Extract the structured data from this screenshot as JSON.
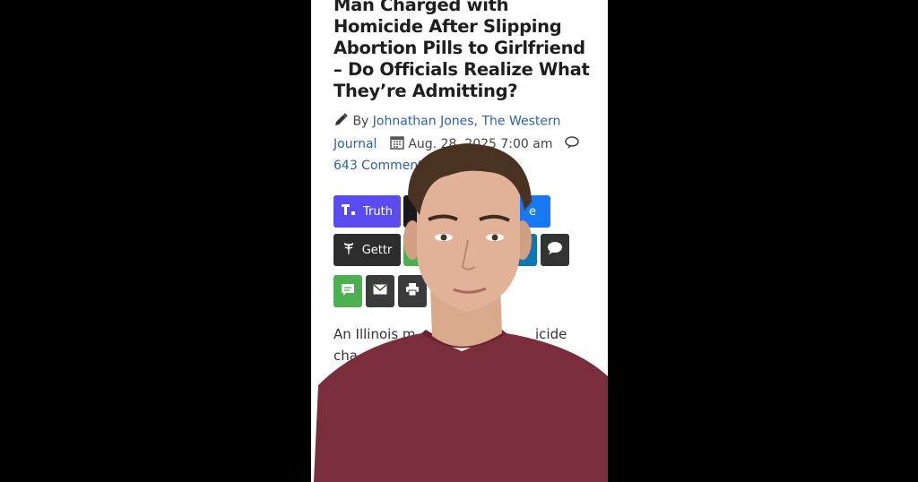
{
  "article": {
    "headline_lines": [
      "Man Charged with",
      "Homicide After Slipping",
      "Abortion Pills to Girlfriend",
      "– Do Officials Realize What",
      "They’re Admitting?"
    ],
    "byline_prefix": "By",
    "author_line1": "Johnathan Jones, The Western",
    "author_line2": "Journal",
    "date": "Aug. 28, 2025 7:00 am",
    "comments": "643 Comments"
  },
  "share": {
    "truth_label": "Truth",
    "gettr_label": "Gettr",
    "partial_label_1": "e",
    "partial_label_2": "in"
  },
  "body": {
    "line1_left": "An Illinois m",
    "line1_right": "icide",
    "line2_left": "cha"
  },
  "icons": [
    "pencil-icon",
    "calendar-icon",
    "comment-icon",
    "truth-social-icon",
    "gettr-icon",
    "speech-bubble-icon",
    "sms-icon",
    "email-icon",
    "print-icon"
  ],
  "colors": {
    "background": "#000000",
    "page": "#ffffff",
    "link": "#2f5fa6",
    "truth": "#5b4cf0",
    "gettr": "#2d2d2d",
    "facebook": "#1877f2",
    "linkedin": "#0a78b7",
    "sms": "#4caf50",
    "dark_button": "#3b3b3b",
    "shirt": "#7a2d3a"
  }
}
